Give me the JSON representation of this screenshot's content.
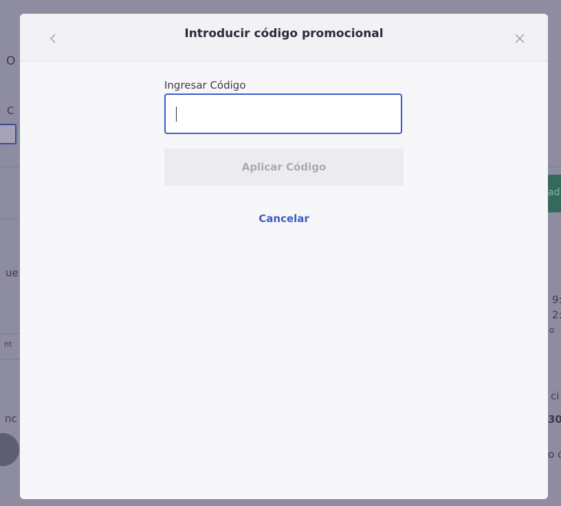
{
  "modal": {
    "title": "Introducir código promocional",
    "back_icon": "chevron-left-icon",
    "close_icon": "close-icon",
    "field_label": "Ingresar Código",
    "input_value": "",
    "apply_label": "Aplicar Código",
    "cancel_label": "Cancelar"
  },
  "background": {
    "fragments": [
      "O",
      "C",
      "ue",
      "nt",
      "nc",
      "ad",
      "9:",
      "2:",
      "o",
      "ci",
      "30",
      "o d"
    ]
  },
  "colors": {
    "accent": "#3d5bc4",
    "title_text": "#2b2a3c",
    "disabled_button": "#ececf0",
    "overlay": "#8e8ca0"
  }
}
